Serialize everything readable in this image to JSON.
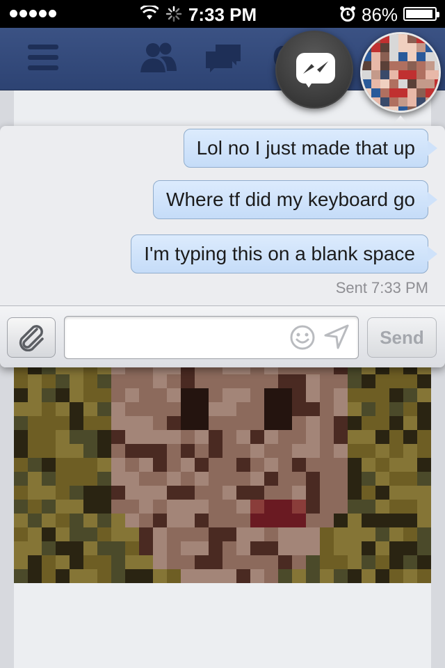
{
  "status_bar": {
    "time": "7:33 PM",
    "battery": "86%",
    "battery_level": 0.86,
    "signal_bars": 5
  },
  "nav": {
    "icons": [
      "menu-icon",
      "friend-requests-icon",
      "messages-icon",
      "notifications-icon"
    ],
    "accent": "#3b5284"
  },
  "chat_heads": {
    "messenger_icon": "messenger-icon",
    "avatar": "contact-avatar"
  },
  "chat": {
    "messages": [
      {
        "text": "Lol no I just made that up",
        "outgoing": true
      },
      {
        "text": "Where tf did my keyboard go",
        "outgoing": true
      },
      {
        "text": "I'm typing this on a blank space",
        "outgoing": true
      }
    ],
    "status": "Sent 7:33 PM",
    "bubble_color": "#d3e5fb"
  },
  "composer": {
    "input_value": "",
    "placeholder": "",
    "send_label": "Send",
    "icons": [
      "paperclip-icon",
      "emoji-icon",
      "location-arrow-icon"
    ]
  }
}
